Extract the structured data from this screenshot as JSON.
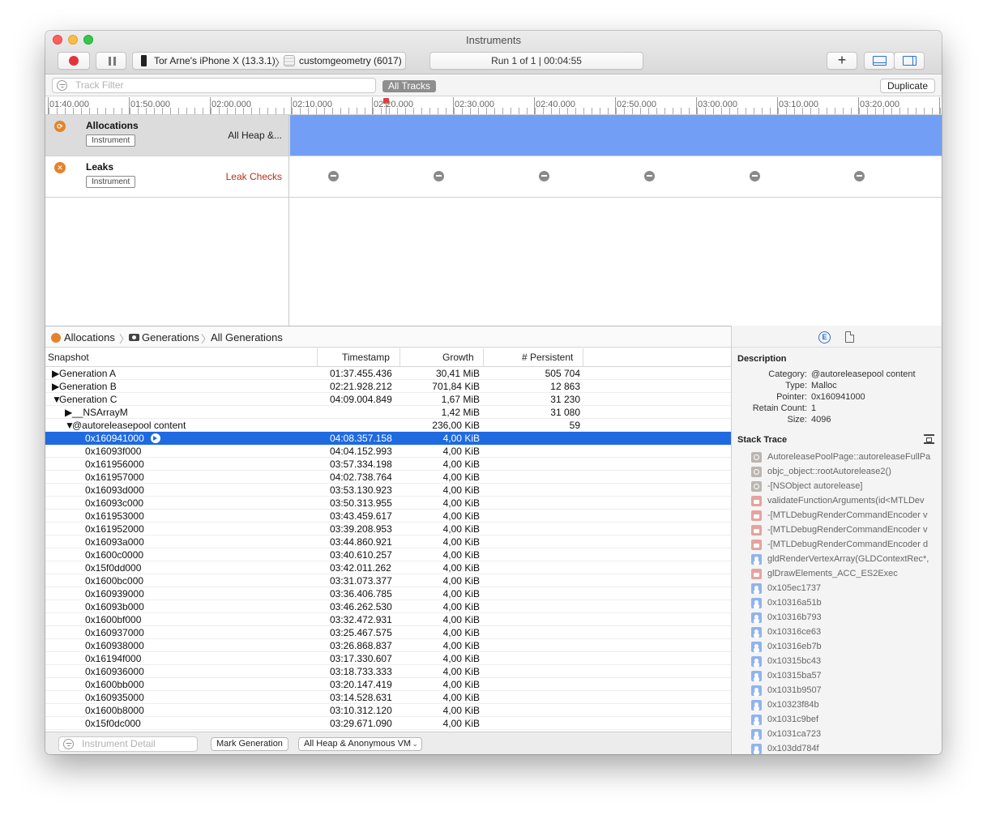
{
  "window": {
    "title": "Instruments"
  },
  "toolbar": {
    "device": "Tor Arne's iPhone X (13.3.1)",
    "process": "customgeometry (6017)",
    "run_status": "Run 1 of 1  |  00:04:55",
    "add_label": "+"
  },
  "filterbar": {
    "track_filter_placeholder": "Track Filter",
    "all_tracks": "All Tracks",
    "duplicate": "Duplicate"
  },
  "ruler": {
    "ticks": [
      "01:40.000",
      "01:50.000",
      "02:00.000",
      "02:10.000",
      "02:20.000",
      "02:30.000",
      "02:40.000",
      "02:50.000",
      "03:00.000",
      "03:10.000",
      "03:20.000"
    ]
  },
  "tracks": [
    {
      "name": "Allocations",
      "badge": "Instrument",
      "subtitle": "All Heap &...",
      "icon": "allocations-icon"
    },
    {
      "name": "Leaks",
      "badge": "Instrument",
      "subtitle": "Leak Checks",
      "icon": "leaks-icon"
    }
  ],
  "breadcrumb": {
    "allocations": "Allocations",
    "generations": "Generations",
    "all_generations": "All Generations"
  },
  "table": {
    "columns": {
      "snapshot": "Snapshot",
      "timestamp": "Timestamp",
      "growth": "Growth",
      "persistent": "# Persistent"
    },
    "rows": [
      {
        "snapshot": "Generation A",
        "disclosure": "▶",
        "timestamp": "01:37.455.436",
        "growth": "30,41 MiB",
        "persistent": "505 704"
      },
      {
        "snapshot": "Generation B",
        "disclosure": "▶",
        "timestamp": "02:21.928.212",
        "growth": "701,84 KiB",
        "persistent": "12 863"
      },
      {
        "snapshot": "Generation C",
        "disclosure": "▼",
        "timestamp": "04:09.004.849",
        "growth": "1,67 MiB",
        "persistent": "31 230"
      },
      {
        "snapshot": "__NSArrayM",
        "disclosure": "▶",
        "timestamp": "",
        "growth": "1,42 MiB",
        "persistent": "31 080"
      },
      {
        "snapshot": "@autoreleasepool content",
        "disclosure": "▼",
        "timestamp": "",
        "growth": "236,00 KiB",
        "persistent": "59"
      },
      {
        "snapshot": "0x160941000",
        "timestamp": "04:08.357.158",
        "growth": "4,00 KiB",
        "persistent": ""
      },
      {
        "snapshot": "0x16093f000",
        "timestamp": "04:04.152.993",
        "growth": "4,00 KiB",
        "persistent": ""
      },
      {
        "snapshot": "0x161956000",
        "timestamp": "03:57.334.198",
        "growth": "4,00 KiB",
        "persistent": ""
      },
      {
        "snapshot": "0x161957000",
        "timestamp": "04:02.738.764",
        "growth": "4,00 KiB",
        "persistent": ""
      },
      {
        "snapshot": "0x16093d000",
        "timestamp": "03:53.130.923",
        "growth": "4,00 KiB",
        "persistent": ""
      },
      {
        "snapshot": "0x16093c000",
        "timestamp": "03:50.313.955",
        "growth": "4,00 KiB",
        "persistent": ""
      },
      {
        "snapshot": "0x161953000",
        "timestamp": "03:43.459.617",
        "growth": "4,00 KiB",
        "persistent": ""
      },
      {
        "snapshot": "0x161952000",
        "timestamp": "03:39.208.953",
        "growth": "4,00 KiB",
        "persistent": ""
      },
      {
        "snapshot": "0x16093a000",
        "timestamp": "03:44.860.921",
        "growth": "4,00 KiB",
        "persistent": ""
      },
      {
        "snapshot": "0x1600c0000",
        "timestamp": "03:40.610.257",
        "growth": "4,00 KiB",
        "persistent": ""
      },
      {
        "snapshot": "0x15f0dd000",
        "timestamp": "03:42.011.262",
        "growth": "4,00 KiB",
        "persistent": ""
      },
      {
        "snapshot": "0x1600bc000",
        "timestamp": "03:31.073.377",
        "growth": "4,00 KiB",
        "persistent": ""
      },
      {
        "snapshot": "0x160939000",
        "timestamp": "03:36.406.785",
        "growth": "4,00 KiB",
        "persistent": ""
      },
      {
        "snapshot": "0x16093b000",
        "timestamp": "03:46.262.530",
        "growth": "4,00 KiB",
        "persistent": ""
      },
      {
        "snapshot": "0x1600bf000",
        "timestamp": "03:32.472.931",
        "growth": "4,00 KiB",
        "persistent": ""
      },
      {
        "snapshot": "0x160937000",
        "timestamp": "03:25.467.575",
        "growth": "4,00 KiB",
        "persistent": ""
      },
      {
        "snapshot": "0x160938000",
        "timestamp": "03:26.868.837",
        "growth": "4,00 KiB",
        "persistent": ""
      },
      {
        "snapshot": "0x16194f000",
        "timestamp": "03:17.330.607",
        "growth": "4,00 KiB",
        "persistent": ""
      },
      {
        "snapshot": "0x160936000",
        "timestamp": "03:18.733.333",
        "growth": "4,00 KiB",
        "persistent": ""
      },
      {
        "snapshot": "0x1600bb000",
        "timestamp": "03:20.147.419",
        "growth": "4,00 KiB",
        "persistent": ""
      },
      {
        "snapshot": "0x160935000",
        "timestamp": "03:14.528.631",
        "growth": "4,00 KiB",
        "persistent": ""
      },
      {
        "snapshot": "0x1600b8000",
        "timestamp": "03:10.312.120",
        "growth": "4,00 KiB",
        "persistent": ""
      },
      {
        "snapshot": "0x15f0dc000",
        "timestamp": "03:29.671.090",
        "growth": "4,00 KiB",
        "persistent": ""
      }
    ]
  },
  "bottombar": {
    "instrument_detail_placeholder": "Instrument Detail",
    "mark_generation": "Mark Generation",
    "heap_select": "All Heap & Anonymous VM",
    "select_arrows": "⌃⌄"
  },
  "inspector": {
    "ext_tab_glyph": "E",
    "description_heading": "Description",
    "details": [
      {
        "key": "Category:",
        "value": "@autoreleasepool content"
      },
      {
        "key": "Type:",
        "value": "Malloc"
      },
      {
        "key": "Pointer:",
        "value": "0x160941000"
      },
      {
        "key": "Retain Count:",
        "value": "1"
      },
      {
        "key": "Size:",
        "value": "4096"
      }
    ],
    "stack_heading": "Stack Trace",
    "stack": [
      {
        "text": "AutoreleasePoolPage::autoreleaseFullPa",
        "icon": "gear"
      },
      {
        "text": "objc_object::rootAutorelease2()",
        "icon": "gear"
      },
      {
        "text": "-[NSObject autorelease]",
        "icon": "gear"
      },
      {
        "text": "validateFunctionArguments(id<MTLDev",
        "icon": "case"
      },
      {
        "text": "-[MTLDebugRenderCommandEncoder v",
        "icon": "case"
      },
      {
        "text": "-[MTLDebugRenderCommandEncoder v",
        "icon": "case"
      },
      {
        "text": "-[MTLDebugRenderCommandEncoder d",
        "icon": "case"
      },
      {
        "text": "gldRenderVertexArray(GLDContextRec*,",
        "icon": "user"
      },
      {
        "text": "glDrawElements_ACC_ES2Exec",
        "icon": "case"
      },
      {
        "text": "0x105ec1737",
        "icon": "user"
      },
      {
        "text": "0x10316a51b",
        "icon": "user"
      },
      {
        "text": "0x10316b793",
        "icon": "user"
      },
      {
        "text": "0x10316ce63",
        "icon": "user"
      },
      {
        "text": "0x10316eb7b",
        "icon": "user"
      },
      {
        "text": "0x10315bc43",
        "icon": "user"
      },
      {
        "text": "0x10315ba57",
        "icon": "user"
      },
      {
        "text": "0x1031b9507",
        "icon": "user"
      },
      {
        "text": "0x10323f84b",
        "icon": "user"
      },
      {
        "text": "0x1031c9bef",
        "icon": "user"
      },
      {
        "text": "0x1031ca723",
        "icon": "user"
      },
      {
        "text": "0x103dd784f",
        "icon": "user"
      }
    ]
  },
  "colors": {
    "selection": "#1f6ae0",
    "allocations_graph": "#729ff5",
    "record": "#e3333b",
    "leak_checks_text": "#b2311d"
  }
}
